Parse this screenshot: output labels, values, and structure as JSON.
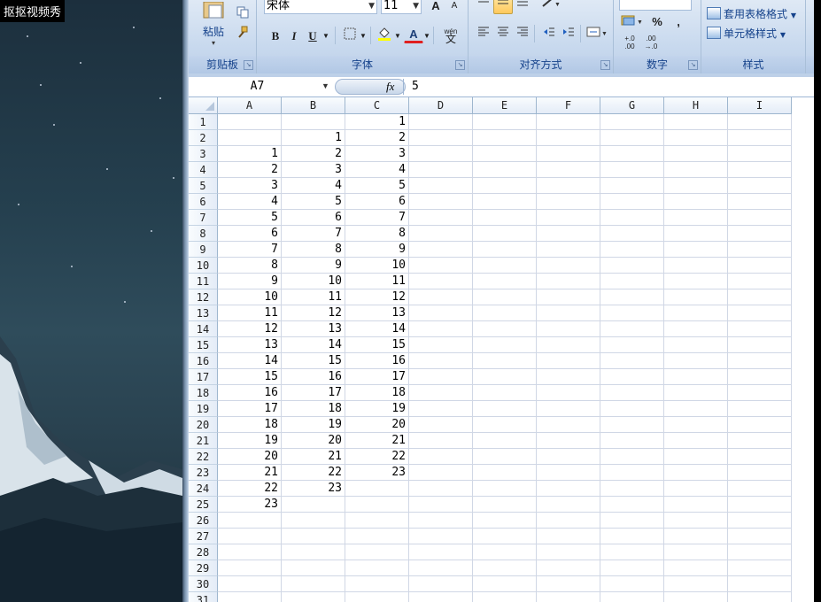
{
  "overlay": {
    "brand": "抠抠视频秀"
  },
  "ribbon": {
    "groups": [
      {
        "label": "剪贴板",
        "paste_label": "粘贴"
      },
      {
        "label": "字体",
        "font_name": "宋体",
        "font_size": "11",
        "bold": "B",
        "italic": "I",
        "underline": "U",
        "grow": "A",
        "shrink": "A",
        "font_color_glyph": "A",
        "phonetic": "wén"
      },
      {
        "label": "对齐方式"
      },
      {
        "label": "数字",
        "percent": "%",
        "comma": ",",
        "inc_decimal": "+.0 .00",
        "dec_decimal": ".00 →.0"
      },
      {
        "label": "样式",
        "format_as_table": "套用表格格式",
        "cell_styles": "单元格样式"
      }
    ],
    "colors": {
      "active": "#ffc95d",
      "label_text": "#15428b"
    }
  },
  "formula_bar": {
    "name_box": "A7",
    "fx": "fx",
    "value": "5"
  },
  "sheet": {
    "columns": [
      "A",
      "B",
      "C",
      "D",
      "E",
      "F",
      "G",
      "H",
      "I"
    ],
    "rows": [
      "1",
      "2",
      "3",
      "4",
      "5",
      "6",
      "7",
      "8",
      "9",
      "10",
      "11",
      "12",
      "13",
      "14",
      "15",
      "16",
      "17",
      "18",
      "19",
      "20",
      "21",
      "22",
      "23",
      "24",
      "25",
      "26",
      "27",
      "28",
      "29",
      "30",
      "31"
    ],
    "cells": [
      [
        "",
        "",
        "1"
      ],
      [
        "",
        "1",
        "2"
      ],
      [
        "1",
        "2",
        "3"
      ],
      [
        "2",
        "3",
        "4"
      ],
      [
        "3",
        "4",
        "5"
      ],
      [
        "4",
        "5",
        "6"
      ],
      [
        "5",
        "6",
        "7"
      ],
      [
        "6",
        "7",
        "8"
      ],
      [
        "7",
        "8",
        "9"
      ],
      [
        "8",
        "9",
        "10"
      ],
      [
        "9",
        "10",
        "11"
      ],
      [
        "10",
        "11",
        "12"
      ],
      [
        "11",
        "12",
        "13"
      ],
      [
        "12",
        "13",
        "14"
      ],
      [
        "13",
        "14",
        "15"
      ],
      [
        "14",
        "15",
        "16"
      ],
      [
        "15",
        "16",
        "17"
      ],
      [
        "16",
        "17",
        "18"
      ],
      [
        "17",
        "18",
        "19"
      ],
      [
        "18",
        "19",
        "20"
      ],
      [
        "19",
        "20",
        "21"
      ],
      [
        "20",
        "21",
        "22"
      ],
      [
        "21",
        "22",
        "23"
      ],
      [
        "22",
        "23",
        ""
      ],
      [
        "23",
        "",
        ""
      ]
    ]
  }
}
